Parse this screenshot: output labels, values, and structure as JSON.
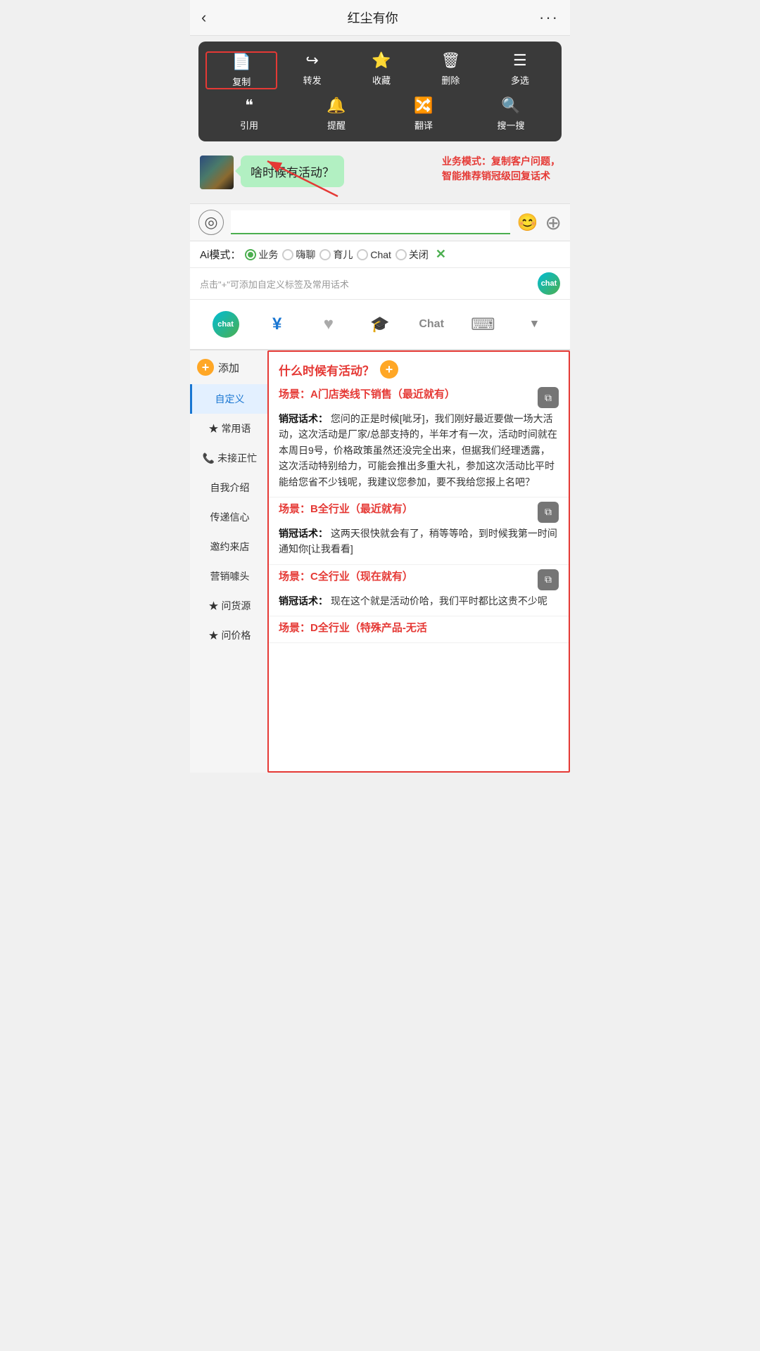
{
  "header": {
    "back_icon": "‹",
    "title": "红尘有你",
    "more_icon": "···"
  },
  "context_menu": {
    "row1": [
      {
        "icon": "📄",
        "label": "复制",
        "selected": true
      },
      {
        "icon": "↪",
        "label": "转发"
      },
      {
        "icon": "🎁",
        "label": "收藏"
      },
      {
        "icon": "🗑",
        "label": "删除"
      },
      {
        "icon": "☰",
        "label": "多选"
      }
    ],
    "row2": [
      {
        "icon": "❝",
        "label": "引用"
      },
      {
        "icon": "🔔",
        "label": "提醒"
      },
      {
        "icon": "🔀",
        "label": "翻译"
      },
      {
        "icon": "🔍",
        "label": "搜一搜"
      }
    ]
  },
  "chat": {
    "bubble_text": "啥时候有活动？"
  },
  "annotation": {
    "text": "业务模式：复制客户问题，\n智能推荐销冠级回复话术"
  },
  "input_bar": {
    "voice_icon": "◎",
    "placeholder": "",
    "emoji_icon": "😊",
    "add_icon": "+"
  },
  "ai_mode": {
    "label": "Ai模式：",
    "options": [
      "业务",
      "嗨聊",
      "育儿",
      "Chat",
      "关闭"
    ],
    "active_index": 0,
    "close_icon": "✕"
  },
  "tip_bar": {
    "text": "点击\"+\"可添加自定义标签及常用话术",
    "chat_icon": "chat"
  },
  "toolbar": {
    "items": [
      {
        "icon": "chat",
        "type": "robot"
      },
      {
        "icon": "¥",
        "type": "text",
        "active": true
      },
      {
        "icon": "♥",
        "type": "text"
      },
      {
        "icon": "🎓",
        "type": "text"
      },
      {
        "icon": "Chat",
        "type": "text",
        "active": false
      },
      {
        "icon": "⌨",
        "type": "text"
      },
      {
        "icon": "▼",
        "type": "text"
      }
    ]
  },
  "sidebar": {
    "add_label": "添加",
    "items": [
      {
        "label": "自定义",
        "active": true
      },
      {
        "label": "常用语",
        "star": true
      },
      {
        "label": "未接正忙",
        "phone": true
      },
      {
        "label": "自我介绍"
      },
      {
        "label": "传递信心"
      },
      {
        "label": "邀约来店"
      },
      {
        "label": "营销噱头"
      },
      {
        "label": "问货源",
        "star": true
      },
      {
        "label": "问价格",
        "star": true
      }
    ]
  },
  "right_panel": {
    "question": "什么时候有活动？",
    "scenes": [
      {
        "scene_label": "场景：A门店类线下销售（最近就有）",
        "content_label": "销冠话术：",
        "content": "您问的正是时候[呲牙]，我们刚好最近要做一场大活动，这次活动是厂家/总部支持的，半年才有一次，活动时间就在本周日9号，价格政策虽然还没完全出来，但据我们经理透露，这次活动特别给力，可能会推出多重大礼，参加这次活动比平时能给您省不少钱呢，我建议您参加，要不我给您报上名吧？"
      },
      {
        "scene_label": "场景：B全行业（最近就有）",
        "content_label": "销冠话术：",
        "content": "这两天很快就会有了，稍等等哈，到时候我第一时间通知你[让我看看]"
      },
      {
        "scene_label": "场景：C全行业（现在就有）",
        "content_label": "销冠话术：",
        "content": "现在这个就是活动价哈，我们平时都比这贵不少呢"
      },
      {
        "scene_label": "场景：D全行业（特殊产品-无活",
        "content_label": "",
        "content": ""
      }
    ]
  }
}
